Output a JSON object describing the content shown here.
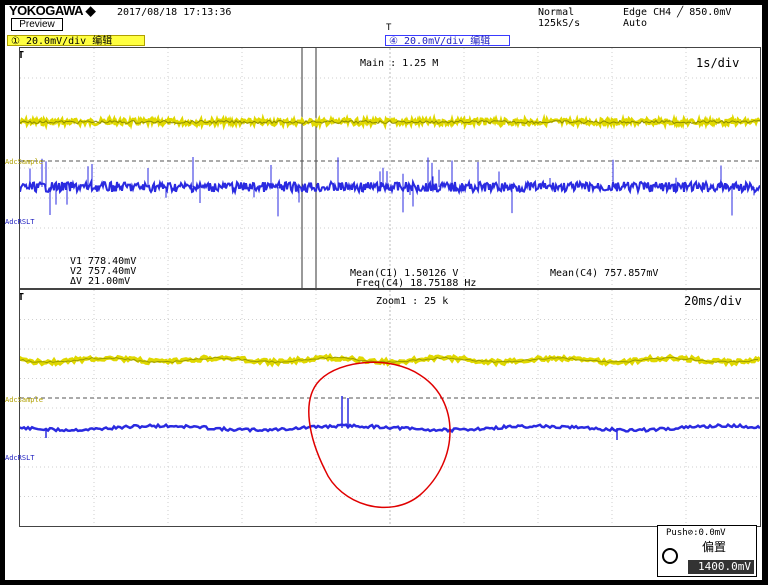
{
  "header": {
    "brand": "YOKOGAWA ◆",
    "datetime": "2017/08/18 17:13:36",
    "preview_label": "Preview",
    "trigger_mark": "T",
    "acq_mode": "Normal",
    "sample_rate": "125kS/s",
    "trigger_type": "Edge CH4 ╱ 850.0mV",
    "trigger_mode": "Auto"
  },
  "channels": {
    "ch1_scale": "① 20.0mV/div 编辑",
    "ch4_scale": "④ 20.0mV/div 编辑",
    "ch1_color": "#e0d800",
    "ch4_color": "#2a2ae0"
  },
  "main": {
    "trigger_marker": "T",
    "record_length": "Main : 1.25 M",
    "timebase": "1s/div",
    "label_adc_sample": "AdcSample",
    "label_adc_rslt": "AdcRSLT"
  },
  "measurements": {
    "v1": "V1   778.40mV",
    "v2": "V2   757.40mV",
    "dv": "ΔV   21.00mV",
    "mean_c1": "Mean(C1)   1.50126 V",
    "freq_c4": "Freq(C4)   18.75188 Hz",
    "mean_c4": "Mean(C4)   757.857mV"
  },
  "zoom": {
    "trigger_marker": "T",
    "zoom_factor": "Zoom1 : 25 k",
    "timebase": "20ms/div",
    "label_adc_sample": "AdcSample",
    "label_adc_rslt": "AdcRSLT"
  },
  "knob": {
    "push_label": "Push⊘:0.0mV",
    "function_label": "偏置",
    "value": "1400.0mV"
  }
}
